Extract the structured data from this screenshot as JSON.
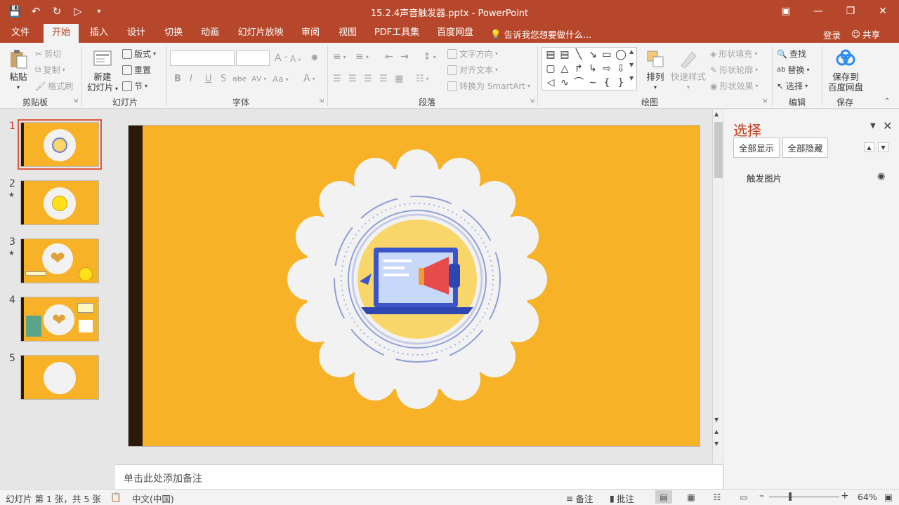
{
  "window": {
    "title": "15.2.4声音触发器.pptx - PowerPoint",
    "controls": [
      "restore-ribbon",
      "minimize",
      "restore",
      "close"
    ]
  },
  "qat": [
    "save-icon",
    "undo-icon",
    "redo-icon",
    "present-icon",
    "customize-icon"
  ],
  "tabs": [
    {
      "label": "文件",
      "active": false
    },
    {
      "label": "开始",
      "active": true
    },
    {
      "label": "插入",
      "active": false
    },
    {
      "label": "设计",
      "active": false
    },
    {
      "label": "切换",
      "active": false
    },
    {
      "label": "动画",
      "active": false
    },
    {
      "label": "幻灯片放映",
      "active": false
    },
    {
      "label": "审阅",
      "active": false
    },
    {
      "label": "视图",
      "active": false
    },
    {
      "label": "PDF工具集",
      "active": false
    },
    {
      "label": "百度网盘",
      "active": false
    }
  ],
  "tell_me": "告诉我您想要做什么...",
  "account": {
    "login": "登录",
    "share": "共享"
  },
  "ribbon": {
    "clipboard": {
      "paste": "粘贴",
      "cut": "剪切",
      "copy": "复制",
      "format_painter": "格式刷",
      "label": "剪贴板"
    },
    "slides": {
      "new_slide_line1": "新建",
      "new_slide_line2": "幻灯片",
      "layout": "版式",
      "reset": "重置",
      "section": "节",
      "label": "幻灯片"
    },
    "font": {
      "label": "字体",
      "bold": "B",
      "italic": "I",
      "underline": "U",
      "shadow": "S",
      "strike": "abc",
      "spacing": "AV",
      "case": "Aa",
      "color": "A",
      "grow": "A",
      "shrink": "A"
    },
    "paragraph": {
      "text_direction": "文字方向",
      "align_text": "对齐文本",
      "smartart": "转换为 SmartArt",
      "label": "段落"
    },
    "drawing": {
      "arrange": "排列",
      "quick_styles": "快速样式",
      "shape_fill": "形状填充",
      "shape_outline": "形状轮廓",
      "shape_effects": "形状效果",
      "label": "绘图"
    },
    "editing": {
      "find": "查找",
      "replace": "替换",
      "select": "选择",
      "label": "编辑"
    },
    "save": {
      "line1": "保存到",
      "line2": "百度网盘",
      "label": "保存"
    }
  },
  "slides": [
    {
      "num": "1",
      "star": false,
      "selected": true
    },
    {
      "num": "2",
      "star": true,
      "selected": false
    },
    {
      "num": "3",
      "star": true,
      "selected": false
    },
    {
      "num": "4",
      "star": false,
      "selected": false
    },
    {
      "num": "5",
      "star": false,
      "selected": false
    }
  ],
  "notes_placeholder": "单击此处添加备注",
  "selection_pane": {
    "title": "选择",
    "show_all": "全部显示",
    "hide_all": "全部隐藏",
    "items": [
      {
        "name": "触发图片",
        "visible": true
      }
    ]
  },
  "status": {
    "slide_info": "幻灯片 第 1 张，共 5 张",
    "language": "中文(中国)",
    "notes": "备注",
    "comments": "批注",
    "zoom": "64%"
  },
  "colors": {
    "brand": "#b7472a",
    "slide_bg": "#f7b228",
    "slide_band": "#2b1a0a",
    "accent_red": "#c43e1c"
  }
}
